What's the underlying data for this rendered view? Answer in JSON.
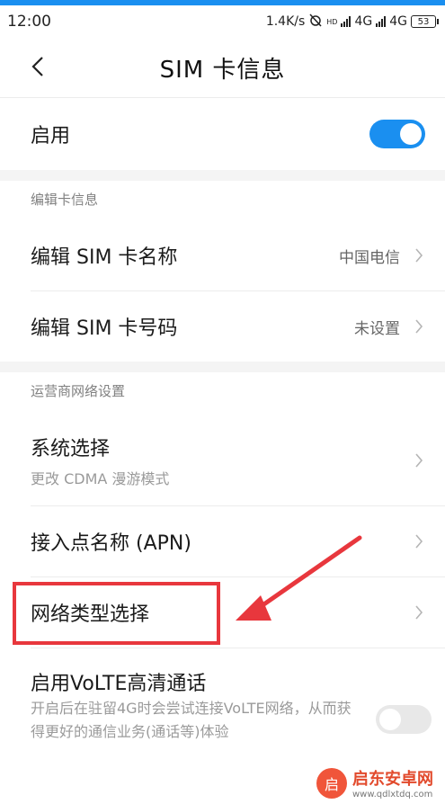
{
  "status_bar": {
    "time": "12:00",
    "net_speed": "1.4K/s",
    "hd": "HD",
    "net_type_1": "4G",
    "net_type_2": "4G",
    "battery": "53"
  },
  "header": {
    "title": "SIM 卡信息"
  },
  "enable_row": {
    "label": "启用",
    "toggle_on": true
  },
  "section_edit": {
    "title": "编辑卡信息",
    "items": [
      {
        "label": "编辑 SIM 卡名称",
        "value": "中国电信"
      },
      {
        "label": "编辑 SIM 卡号码",
        "value": "未设置"
      }
    ]
  },
  "section_carrier": {
    "title": "运营商网络设置",
    "system_select": {
      "label": "系统选择",
      "sub": "更改 CDMA 漫游模式"
    },
    "apn": {
      "label": "接入点名称 (APN)"
    },
    "network_type": {
      "label": "网络类型选择"
    },
    "volte": {
      "label": "启用VoLTE高清通话",
      "desc": "开启后在驻留4G时会尝试连接VoLTE网络，从而获得更好的通信业务(通话等)体验",
      "toggle_on": false
    }
  },
  "watermark": {
    "logo_char": "启",
    "name": "启东安卓网",
    "url": "www.qdlxtdq.com"
  },
  "colors": {
    "accent": "#1a8ff0",
    "highlight": "#e8373d"
  }
}
